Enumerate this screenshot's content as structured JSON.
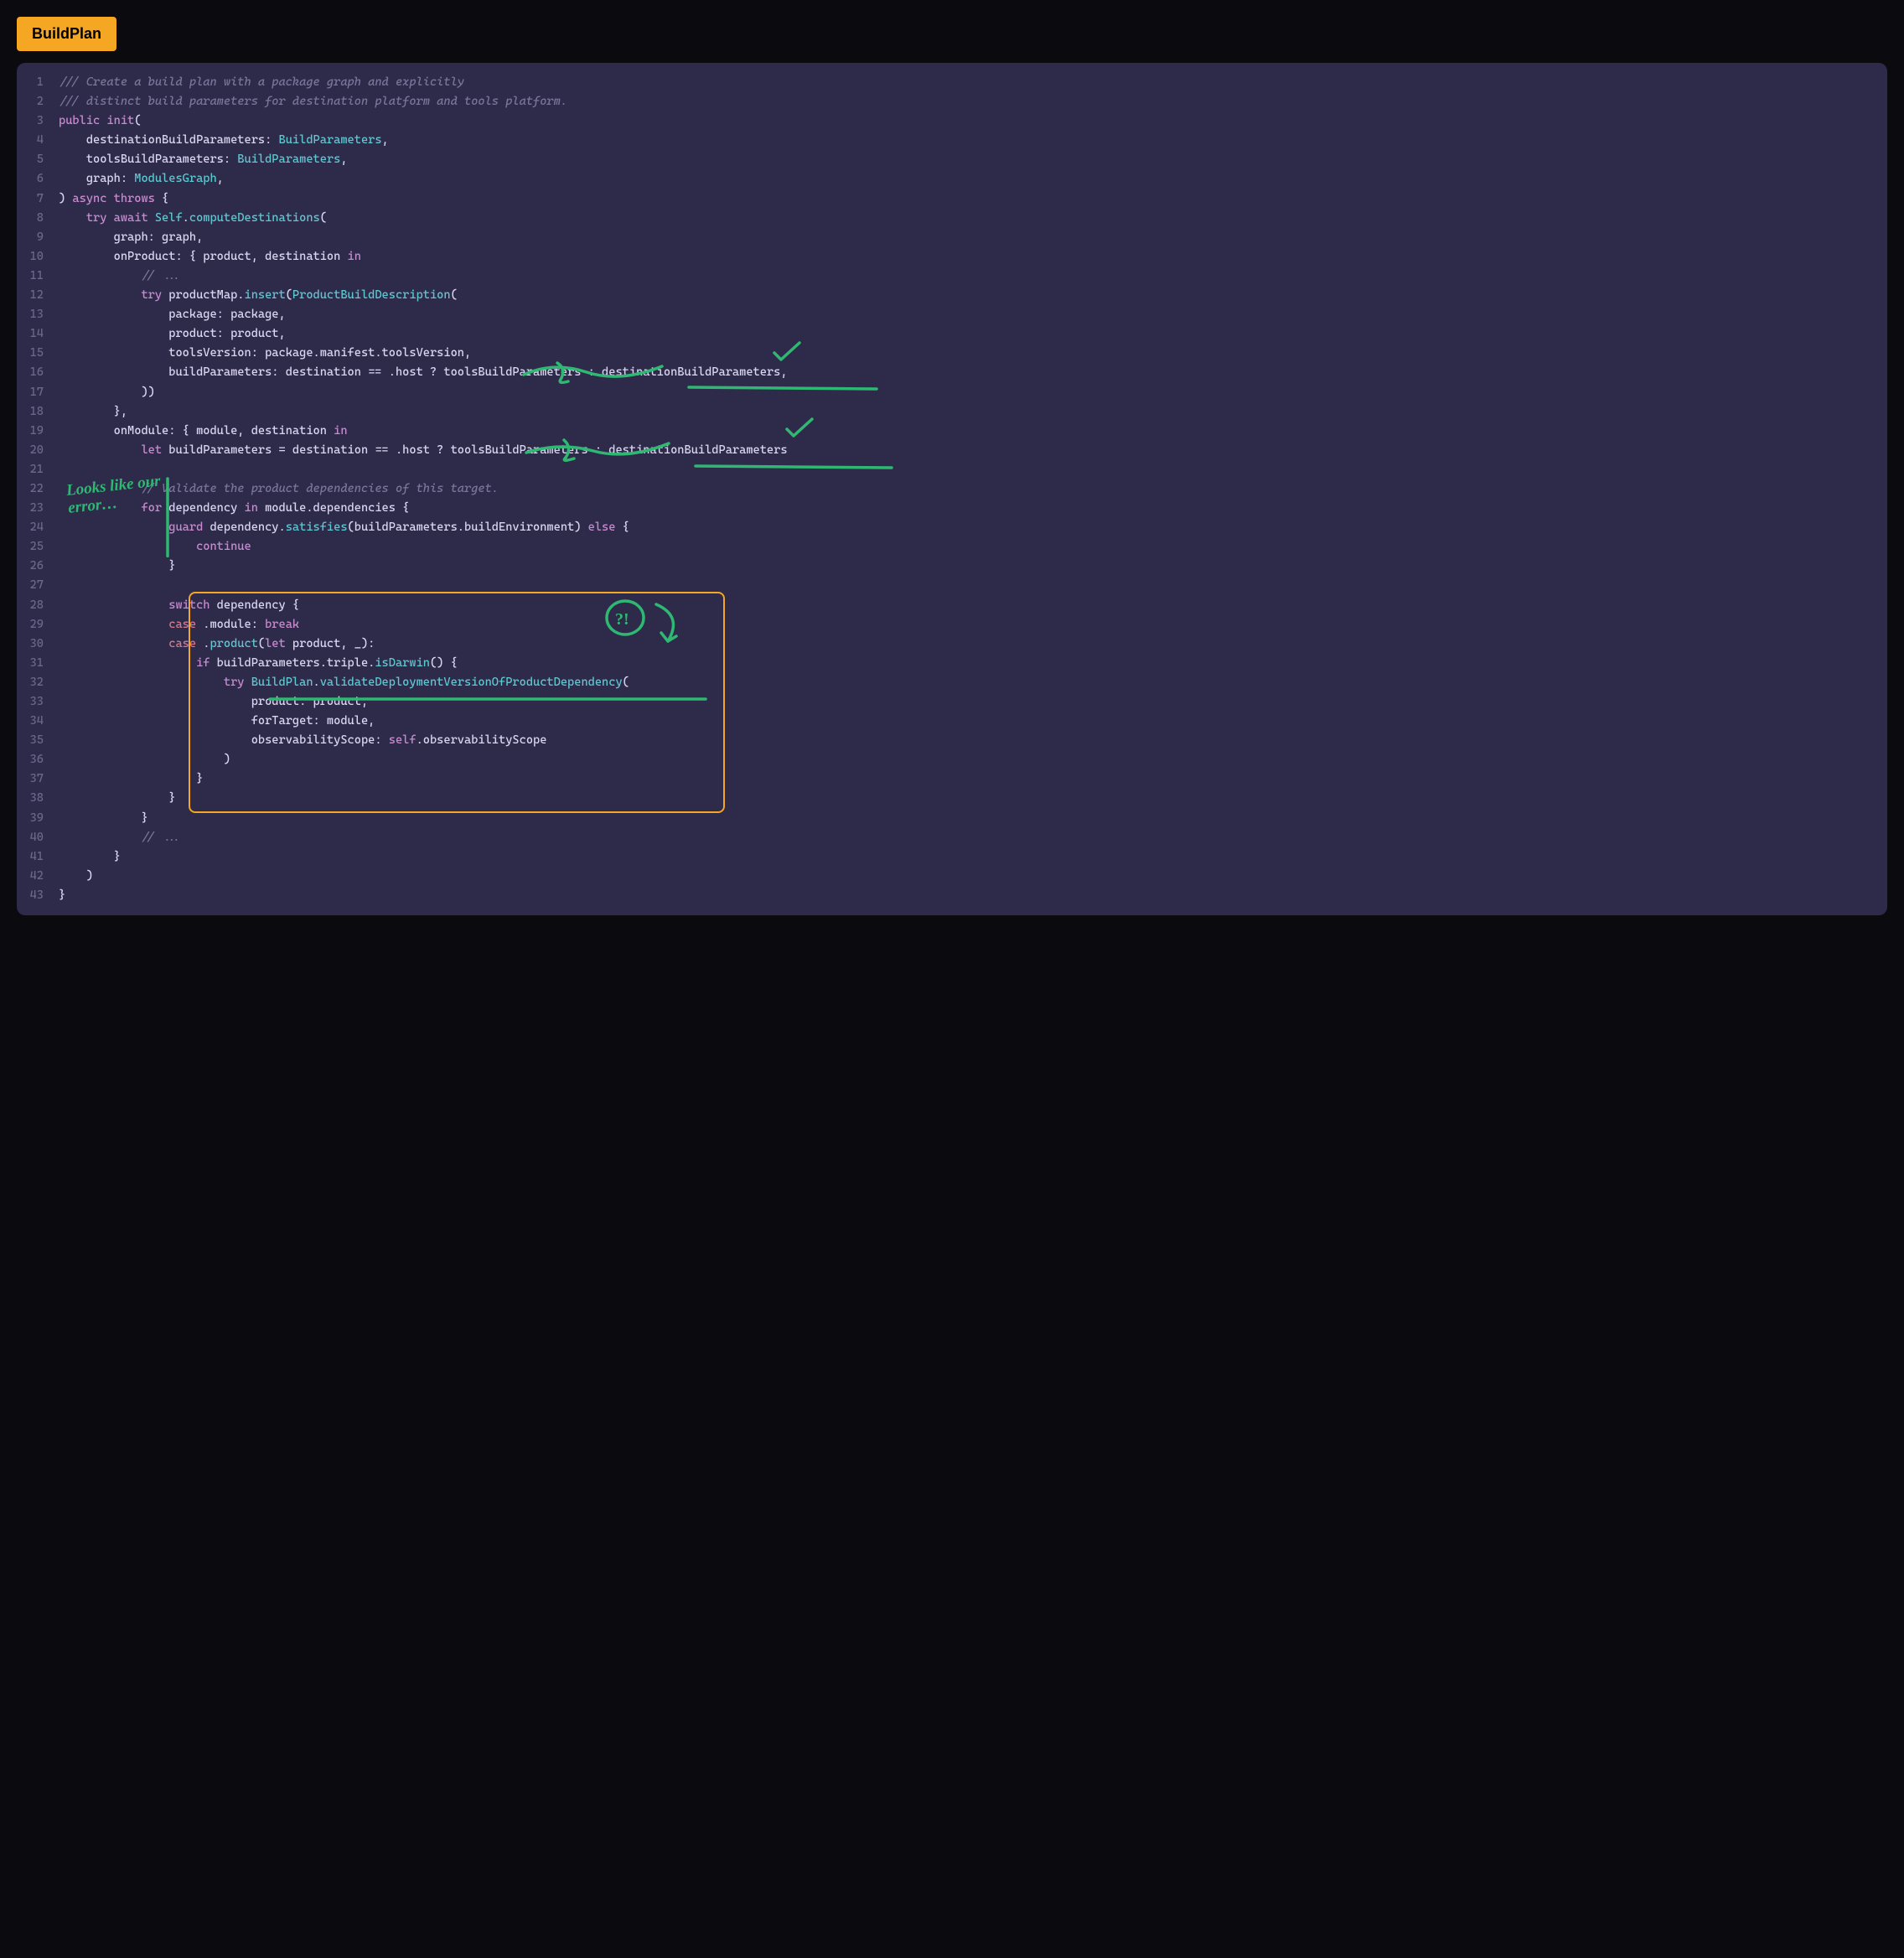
{
  "badge": "BuildPlan",
  "handwriting_note": "Looks like our error…",
  "lines": [
    {
      "n": 1,
      "segs": [
        {
          "c": "cmt",
          "t": "/// Create a build plan with a package graph and explicitly"
        }
      ]
    },
    {
      "n": 2,
      "segs": [
        {
          "c": "cmt",
          "t": "/// distinct build parameters for destination platform and tools platform."
        }
      ]
    },
    {
      "n": 3,
      "segs": [
        {
          "c": "kw",
          "t": "public"
        },
        {
          "c": "txt",
          "t": " "
        },
        {
          "c": "kw",
          "t": "init"
        },
        {
          "c": "txt",
          "t": "("
        }
      ]
    },
    {
      "n": 4,
      "segs": [
        {
          "c": "txt",
          "t": "    destinationBuildParameters: "
        },
        {
          "c": "type",
          "t": "BuildParameters"
        },
        {
          "c": "txt",
          "t": ","
        }
      ]
    },
    {
      "n": 5,
      "segs": [
        {
          "c": "txt",
          "t": "    toolsBuildParameters: "
        },
        {
          "c": "type",
          "t": "BuildParameters"
        },
        {
          "c": "txt",
          "t": ","
        }
      ]
    },
    {
      "n": 6,
      "segs": [
        {
          "c": "txt",
          "t": "    graph: "
        },
        {
          "c": "type",
          "t": "ModulesGraph"
        },
        {
          "c": "txt",
          "t": ","
        }
      ]
    },
    {
      "n": 7,
      "segs": [
        {
          "c": "txt",
          "t": ") "
        },
        {
          "c": "kw",
          "t": "async"
        },
        {
          "c": "txt",
          "t": " "
        },
        {
          "c": "kw",
          "t": "throws"
        },
        {
          "c": "txt",
          "t": " {"
        }
      ]
    },
    {
      "n": 8,
      "segs": [
        {
          "c": "txt",
          "t": "    "
        },
        {
          "c": "kw",
          "t": "try"
        },
        {
          "c": "txt",
          "t": " "
        },
        {
          "c": "kw",
          "t": "await"
        },
        {
          "c": "txt",
          "t": " "
        },
        {
          "c": "type",
          "t": "Self"
        },
        {
          "c": "txt",
          "t": "."
        },
        {
          "c": "fn",
          "t": "computeDestinations"
        },
        {
          "c": "txt",
          "t": "("
        }
      ]
    },
    {
      "n": 9,
      "segs": [
        {
          "c": "txt",
          "t": "        graph: graph,"
        }
      ]
    },
    {
      "n": 10,
      "segs": [
        {
          "c": "txt",
          "t": "        onProduct: { product, destination "
        },
        {
          "c": "kw",
          "t": "in"
        }
      ]
    },
    {
      "n": 11,
      "segs": [
        {
          "c": "txt",
          "t": "            "
        },
        {
          "c": "cmt",
          "t": "// ..."
        }
      ]
    },
    {
      "n": 12,
      "segs": [
        {
          "c": "txt",
          "t": "            "
        },
        {
          "c": "kw",
          "t": "try"
        },
        {
          "c": "txt",
          "t": " productMap."
        },
        {
          "c": "fn",
          "t": "insert"
        },
        {
          "c": "txt",
          "t": "("
        },
        {
          "c": "type",
          "t": "ProductBuildDescription"
        },
        {
          "c": "txt",
          "t": "("
        }
      ]
    },
    {
      "n": 13,
      "segs": [
        {
          "c": "txt",
          "t": "                package: package,"
        }
      ]
    },
    {
      "n": 14,
      "segs": [
        {
          "c": "txt",
          "t": "                product: product,"
        }
      ]
    },
    {
      "n": 15,
      "segs": [
        {
          "c": "txt",
          "t": "                toolsVersion: package.manifest.toolsVersion,"
        }
      ]
    },
    {
      "n": 16,
      "segs": [
        {
          "c": "txt",
          "t": "                buildParameters: destination == .host ? toolsBuildParameters : destinationBuildParameters,"
        }
      ]
    },
    {
      "n": 17,
      "segs": [
        {
          "c": "txt",
          "t": "            ))"
        }
      ]
    },
    {
      "n": 18,
      "segs": [
        {
          "c": "txt",
          "t": "        },"
        }
      ]
    },
    {
      "n": 19,
      "segs": [
        {
          "c": "txt",
          "t": "        onModule: { module, destination "
        },
        {
          "c": "kw",
          "t": "in"
        }
      ]
    },
    {
      "n": 20,
      "segs": [
        {
          "c": "txt",
          "t": "            "
        },
        {
          "c": "kw",
          "t": "let"
        },
        {
          "c": "txt",
          "t": " buildParameters = destination == .host ? toolsBuildParameters : destinationBuildParameters"
        }
      ]
    },
    {
      "n": 21,
      "segs": [
        {
          "c": "txt",
          "t": ""
        }
      ]
    },
    {
      "n": 22,
      "segs": [
        {
          "c": "txt",
          "t": "            "
        },
        {
          "c": "cmt",
          "t": "// Validate the product dependencies of this target."
        }
      ]
    },
    {
      "n": 23,
      "segs": [
        {
          "c": "txt",
          "t": "            "
        },
        {
          "c": "kw",
          "t": "for"
        },
        {
          "c": "txt",
          "t": " dependency "
        },
        {
          "c": "kw",
          "t": "in"
        },
        {
          "c": "txt",
          "t": " module.dependencies {"
        }
      ]
    },
    {
      "n": 24,
      "segs": [
        {
          "c": "txt",
          "t": "                "
        },
        {
          "c": "kw",
          "t": "guard"
        },
        {
          "c": "txt",
          "t": " dependency."
        },
        {
          "c": "fn",
          "t": "satisfies"
        },
        {
          "c": "txt",
          "t": "(buildParameters.buildEnvironment) "
        },
        {
          "c": "kw",
          "t": "else"
        },
        {
          "c": "txt",
          "t": " {"
        }
      ]
    },
    {
      "n": 25,
      "segs": [
        {
          "c": "txt",
          "t": "                    "
        },
        {
          "c": "kw",
          "t": "continue"
        }
      ]
    },
    {
      "n": 26,
      "segs": [
        {
          "c": "txt",
          "t": "                }"
        }
      ]
    },
    {
      "n": 27,
      "segs": [
        {
          "c": "txt",
          "t": ""
        }
      ]
    },
    {
      "n": 28,
      "segs": [
        {
          "c": "txt",
          "t": "                "
        },
        {
          "c": "kw",
          "t": "switch"
        },
        {
          "c": "txt",
          "t": " dependency {"
        }
      ]
    },
    {
      "n": 29,
      "segs": [
        {
          "c": "txt",
          "t": "                "
        },
        {
          "c": "kw2",
          "t": "case"
        },
        {
          "c": "txt",
          "t": " .module: "
        },
        {
          "c": "kw",
          "t": "break"
        }
      ]
    },
    {
      "n": 30,
      "segs": [
        {
          "c": "txt",
          "t": "                "
        },
        {
          "c": "kw2",
          "t": "case"
        },
        {
          "c": "txt",
          "t": " ."
        },
        {
          "c": "fn",
          "t": "product"
        },
        {
          "c": "txt",
          "t": "("
        },
        {
          "c": "kw",
          "t": "let"
        },
        {
          "c": "txt",
          "t": " product, _):"
        }
      ]
    },
    {
      "n": 31,
      "segs": [
        {
          "c": "txt",
          "t": "                    "
        },
        {
          "c": "kw",
          "t": "if"
        },
        {
          "c": "txt",
          "t": " buildParameters.triple."
        },
        {
          "c": "fn",
          "t": "isDarwin"
        },
        {
          "c": "txt",
          "t": "() {"
        }
      ]
    },
    {
      "n": 32,
      "segs": [
        {
          "c": "txt",
          "t": "                        "
        },
        {
          "c": "kw",
          "t": "try"
        },
        {
          "c": "txt",
          "t": " "
        },
        {
          "c": "type",
          "t": "BuildPlan"
        },
        {
          "c": "txt",
          "t": "."
        },
        {
          "c": "fn",
          "t": "validateDeploymentVersionOfProductDependency"
        },
        {
          "c": "txt",
          "t": "("
        }
      ]
    },
    {
      "n": 33,
      "segs": [
        {
          "c": "txt",
          "t": "                            product: product,"
        }
      ]
    },
    {
      "n": 34,
      "segs": [
        {
          "c": "txt",
          "t": "                            forTarget: module,"
        }
      ]
    },
    {
      "n": 35,
      "segs": [
        {
          "c": "txt",
          "t": "                            observabilityScope: "
        },
        {
          "c": "kw",
          "t": "self"
        },
        {
          "c": "txt",
          "t": ".observabilityScope"
        }
      ]
    },
    {
      "n": 36,
      "segs": [
        {
          "c": "txt",
          "t": "                        )"
        }
      ]
    },
    {
      "n": 37,
      "segs": [
        {
          "c": "txt",
          "t": "                    }"
        }
      ]
    },
    {
      "n": 38,
      "segs": [
        {
          "c": "txt",
          "t": "                }"
        }
      ]
    },
    {
      "n": 39,
      "segs": [
        {
          "c": "txt",
          "t": "            }"
        }
      ]
    },
    {
      "n": 40,
      "segs": [
        {
          "c": "txt",
          "t": "            "
        },
        {
          "c": "cmt",
          "t": "// ..."
        }
      ]
    },
    {
      "n": 41,
      "segs": [
        {
          "c": "txt",
          "t": "        }"
        }
      ]
    },
    {
      "n": 42,
      "segs": [
        {
          "c": "txt",
          "t": "    )"
        }
      ]
    },
    {
      "n": 43,
      "segs": [
        {
          "c": "txt",
          "t": "}"
        }
      ]
    }
  ]
}
